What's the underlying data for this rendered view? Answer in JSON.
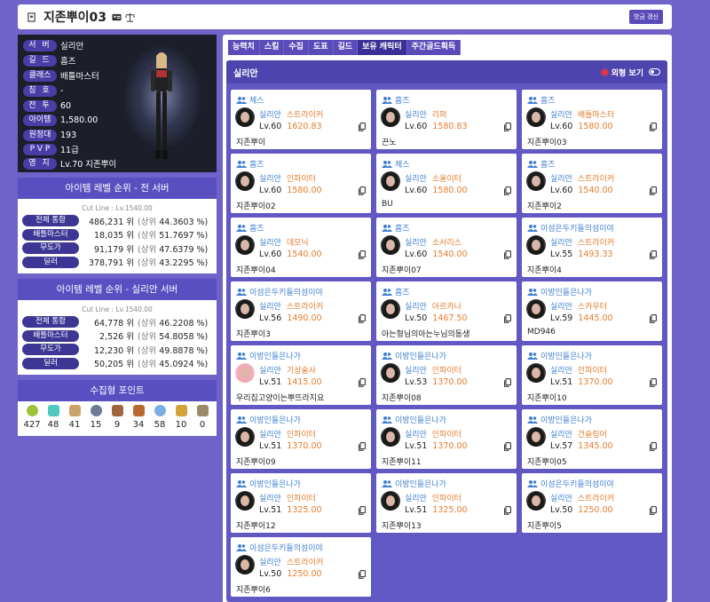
{
  "header": {
    "title": "지존뿌이03",
    "refresh_label": "방금 갱신"
  },
  "profile": {
    "rows": [
      {
        "key": "서 버",
        "value": "실리안"
      },
      {
        "key": "길 드",
        "value": "흠즈"
      },
      {
        "key": "클래스",
        "value": "배틀마스터"
      },
      {
        "key": "칭 호",
        "value": "-"
      },
      {
        "key": "전 투",
        "value": "60"
      },
      {
        "key": "아이템",
        "value": "1,580.00"
      },
      {
        "key": "원정대",
        "value": "193"
      },
      {
        "key": "P V P",
        "value": "11급"
      },
      {
        "key": "영 지",
        "value": "Lv.70 지존뿌이"
      }
    ]
  },
  "rank_all": {
    "title": "아이템 레벨 순위 - 전 서버",
    "cutline": "Cut Line : Lv.1540.00",
    "rows": [
      {
        "label": "전체 통합",
        "rank": "486,231 위",
        "pct_prefix": "(상위",
        "pct": "44.3603 %)"
      },
      {
        "label": "배틀마스터",
        "rank": "18,035 위",
        "pct_prefix": "(상위",
        "pct": "51.7697 %)"
      },
      {
        "label": "무도가",
        "rank": "91,179 위",
        "pct_prefix": "(상위",
        "pct": "47.6379 %)"
      },
      {
        "label": "딜러",
        "rank": "378,791 위",
        "pct_prefix": "(상위",
        "pct": "43.2295 %)"
      }
    ]
  },
  "rank_server": {
    "title": "아이템 레벨 순위 - 실리안 서버",
    "cutline": "Cut Line : Lv.1540.00",
    "rows": [
      {
        "label": "전체 통합",
        "rank": "64,778 위",
        "pct_prefix": "(상위",
        "pct": "46.2208 %)"
      },
      {
        "label": "배틀마스터",
        "rank": "2,526 위",
        "pct_prefix": "(상위",
        "pct": "54.8058 %)"
      },
      {
        "label": "무도가",
        "rank": "12,230 위",
        "pct_prefix": "(상위",
        "pct": "49.8878 %)"
      },
      {
        "label": "딜러",
        "rank": "50,205 위",
        "pct_prefix": "(상위",
        "pct": "45.0924 %)"
      }
    ]
  },
  "collect": {
    "title": "수집형 포인트",
    "items": [
      {
        "icon": "mokoko-seed-icon",
        "color": "#9cc43a",
        "value": "427"
      },
      {
        "icon": "island-heart-icon",
        "color": "#4fc8c0",
        "value": "48"
      },
      {
        "icon": "great-art-icon",
        "color": "#c9a46a",
        "value": "41"
      },
      {
        "icon": "giant-heart-icon",
        "color": "#6c7a96",
        "value": "15"
      },
      {
        "icon": "ignea-token-icon",
        "color": "#a0653c",
        "value": "9"
      },
      {
        "icon": "adventure-tome-icon",
        "color": "#b86a2e",
        "value": "34"
      },
      {
        "icon": "voyage-icon",
        "color": "#7aaee0",
        "value": "58"
      },
      {
        "icon": "world-tree-leaf-icon",
        "color": "#d4a23a",
        "value": "10"
      },
      {
        "icon": "orpheus-star-icon",
        "color": "#9a8a6a",
        "value": "0"
      }
    ]
  },
  "tabs": [
    "능력치",
    "스킬",
    "수집",
    "도표",
    "길드",
    "보유 캐릭터",
    "주간골드획득"
  ],
  "panel": {
    "server_title": "실리안",
    "appearance_label": "외형 보기"
  },
  "characters": [
    {
      "guild": "체스",
      "server": "실리안",
      "job": "스트라이커",
      "level": "Lv.60",
      "item_level": "1620.83",
      "name": "지존뿌이"
    },
    {
      "guild": "흠즈",
      "server": "실리안",
      "job": "리퍼",
      "level": "Lv.60",
      "item_level": "1580.83",
      "name": "끈노"
    },
    {
      "guild": "흠즈",
      "server": "실리안",
      "job": "배틀마스터",
      "level": "Lv.60",
      "item_level": "1580.00",
      "name": "지존뿌이03"
    },
    {
      "guild": "흠즈",
      "server": "실리안",
      "job": "인파이터",
      "level": "Lv.60",
      "item_level": "1580.00",
      "name": "지존뿌이02"
    },
    {
      "guild": "체스",
      "server": "실리안",
      "job": "소울이터",
      "level": "Lv.60",
      "item_level": "1580.00",
      "name": "BU"
    },
    {
      "guild": "흠즈",
      "server": "실리안",
      "job": "스트라이커",
      "level": "Lv.60",
      "item_level": "1540.00",
      "name": "지존뿌이2"
    },
    {
      "guild": "흠즈",
      "server": "실리안",
      "job": "데모닉",
      "level": "Lv.60",
      "item_level": "1540.00",
      "name": "지존뿌이04"
    },
    {
      "guild": "흠즈",
      "server": "실리안",
      "job": "소서리스",
      "level": "Lv.60",
      "item_level": "1540.00",
      "name": "지존뿌이07"
    },
    {
      "guild": "이섬은두키들의섬이야",
      "server": "실리안",
      "job": "스트라이커",
      "level": "Lv.55",
      "item_level": "1493.33",
      "name": "지존뿌이4"
    },
    {
      "guild": "이섬은두키들의섬이야",
      "server": "실리안",
      "job": "스트라이커",
      "level": "Lv.56",
      "item_level": "1490.00",
      "name": "지존뿌이3"
    },
    {
      "guild": "흠즈",
      "server": "실리안",
      "job": "아르카나",
      "level": "Lv.50",
      "item_level": "1467.50",
      "name": "아는형님의아는누님의동생"
    },
    {
      "guild": "이방인들은나가",
      "server": "실리안",
      "job": "스카우터",
      "level": "Lv.59",
      "item_level": "1445.00",
      "name": "MD946"
    },
    {
      "guild": "이방인들은나가",
      "server": "실리안",
      "job": "기상술사",
      "level": "Lv.51",
      "item_level": "1415.00",
      "name": "우리집고양이는뿌뜨라지요"
    },
    {
      "guild": "이방인들은나가",
      "server": "실리안",
      "job": "인파이터",
      "level": "Lv.53",
      "item_level": "1370.00",
      "name": "지존뿌이08"
    },
    {
      "guild": "이방인들은나가",
      "server": "실리안",
      "job": "인파이터",
      "level": "Lv.51",
      "item_level": "1370.00",
      "name": "지존뿌이10"
    },
    {
      "guild": "이방인들은나가",
      "server": "실리안",
      "job": "인파이터",
      "level": "Lv.51",
      "item_level": "1370.00",
      "name": "지존뿌이09"
    },
    {
      "guild": "이방인들은나가",
      "server": "실리안",
      "job": "인파이터",
      "level": "Lv.51",
      "item_level": "1370.00",
      "name": "지존뿌이11"
    },
    {
      "guild": "이방인들은나가",
      "server": "실리안",
      "job": "건슬링어",
      "level": "Lv.57",
      "item_level": "1345.00",
      "name": "지존뿌이05"
    },
    {
      "guild": "이방인들은나가",
      "server": "실리안",
      "job": "인파이터",
      "level": "Lv.51",
      "item_level": "1325.00",
      "name": "지존뿌이12"
    },
    {
      "guild": "이방인들은나가",
      "server": "실리안",
      "job": "인파이터",
      "level": "Lv.51",
      "item_level": "1325.00",
      "name": "지존뿌이13"
    },
    {
      "guild": "이섬은두키들의섬이야",
      "server": "실리안",
      "job": "스트라이커",
      "level": "Lv.50",
      "item_level": "1250.00",
      "name": "지존뿌이5"
    },
    {
      "guild": "이섬은두키들의섬이야",
      "server": "실리안",
      "job": "스트라이커",
      "level": "Lv.50",
      "item_level": "1250.00",
      "name": "지존뿌이6"
    }
  ],
  "colors": {
    "accent": "#5a4bb8",
    "page_bg": "#6f63c9",
    "guild_text": "#3f7fd0",
    "item_level_text": "#e57c2e"
  }
}
